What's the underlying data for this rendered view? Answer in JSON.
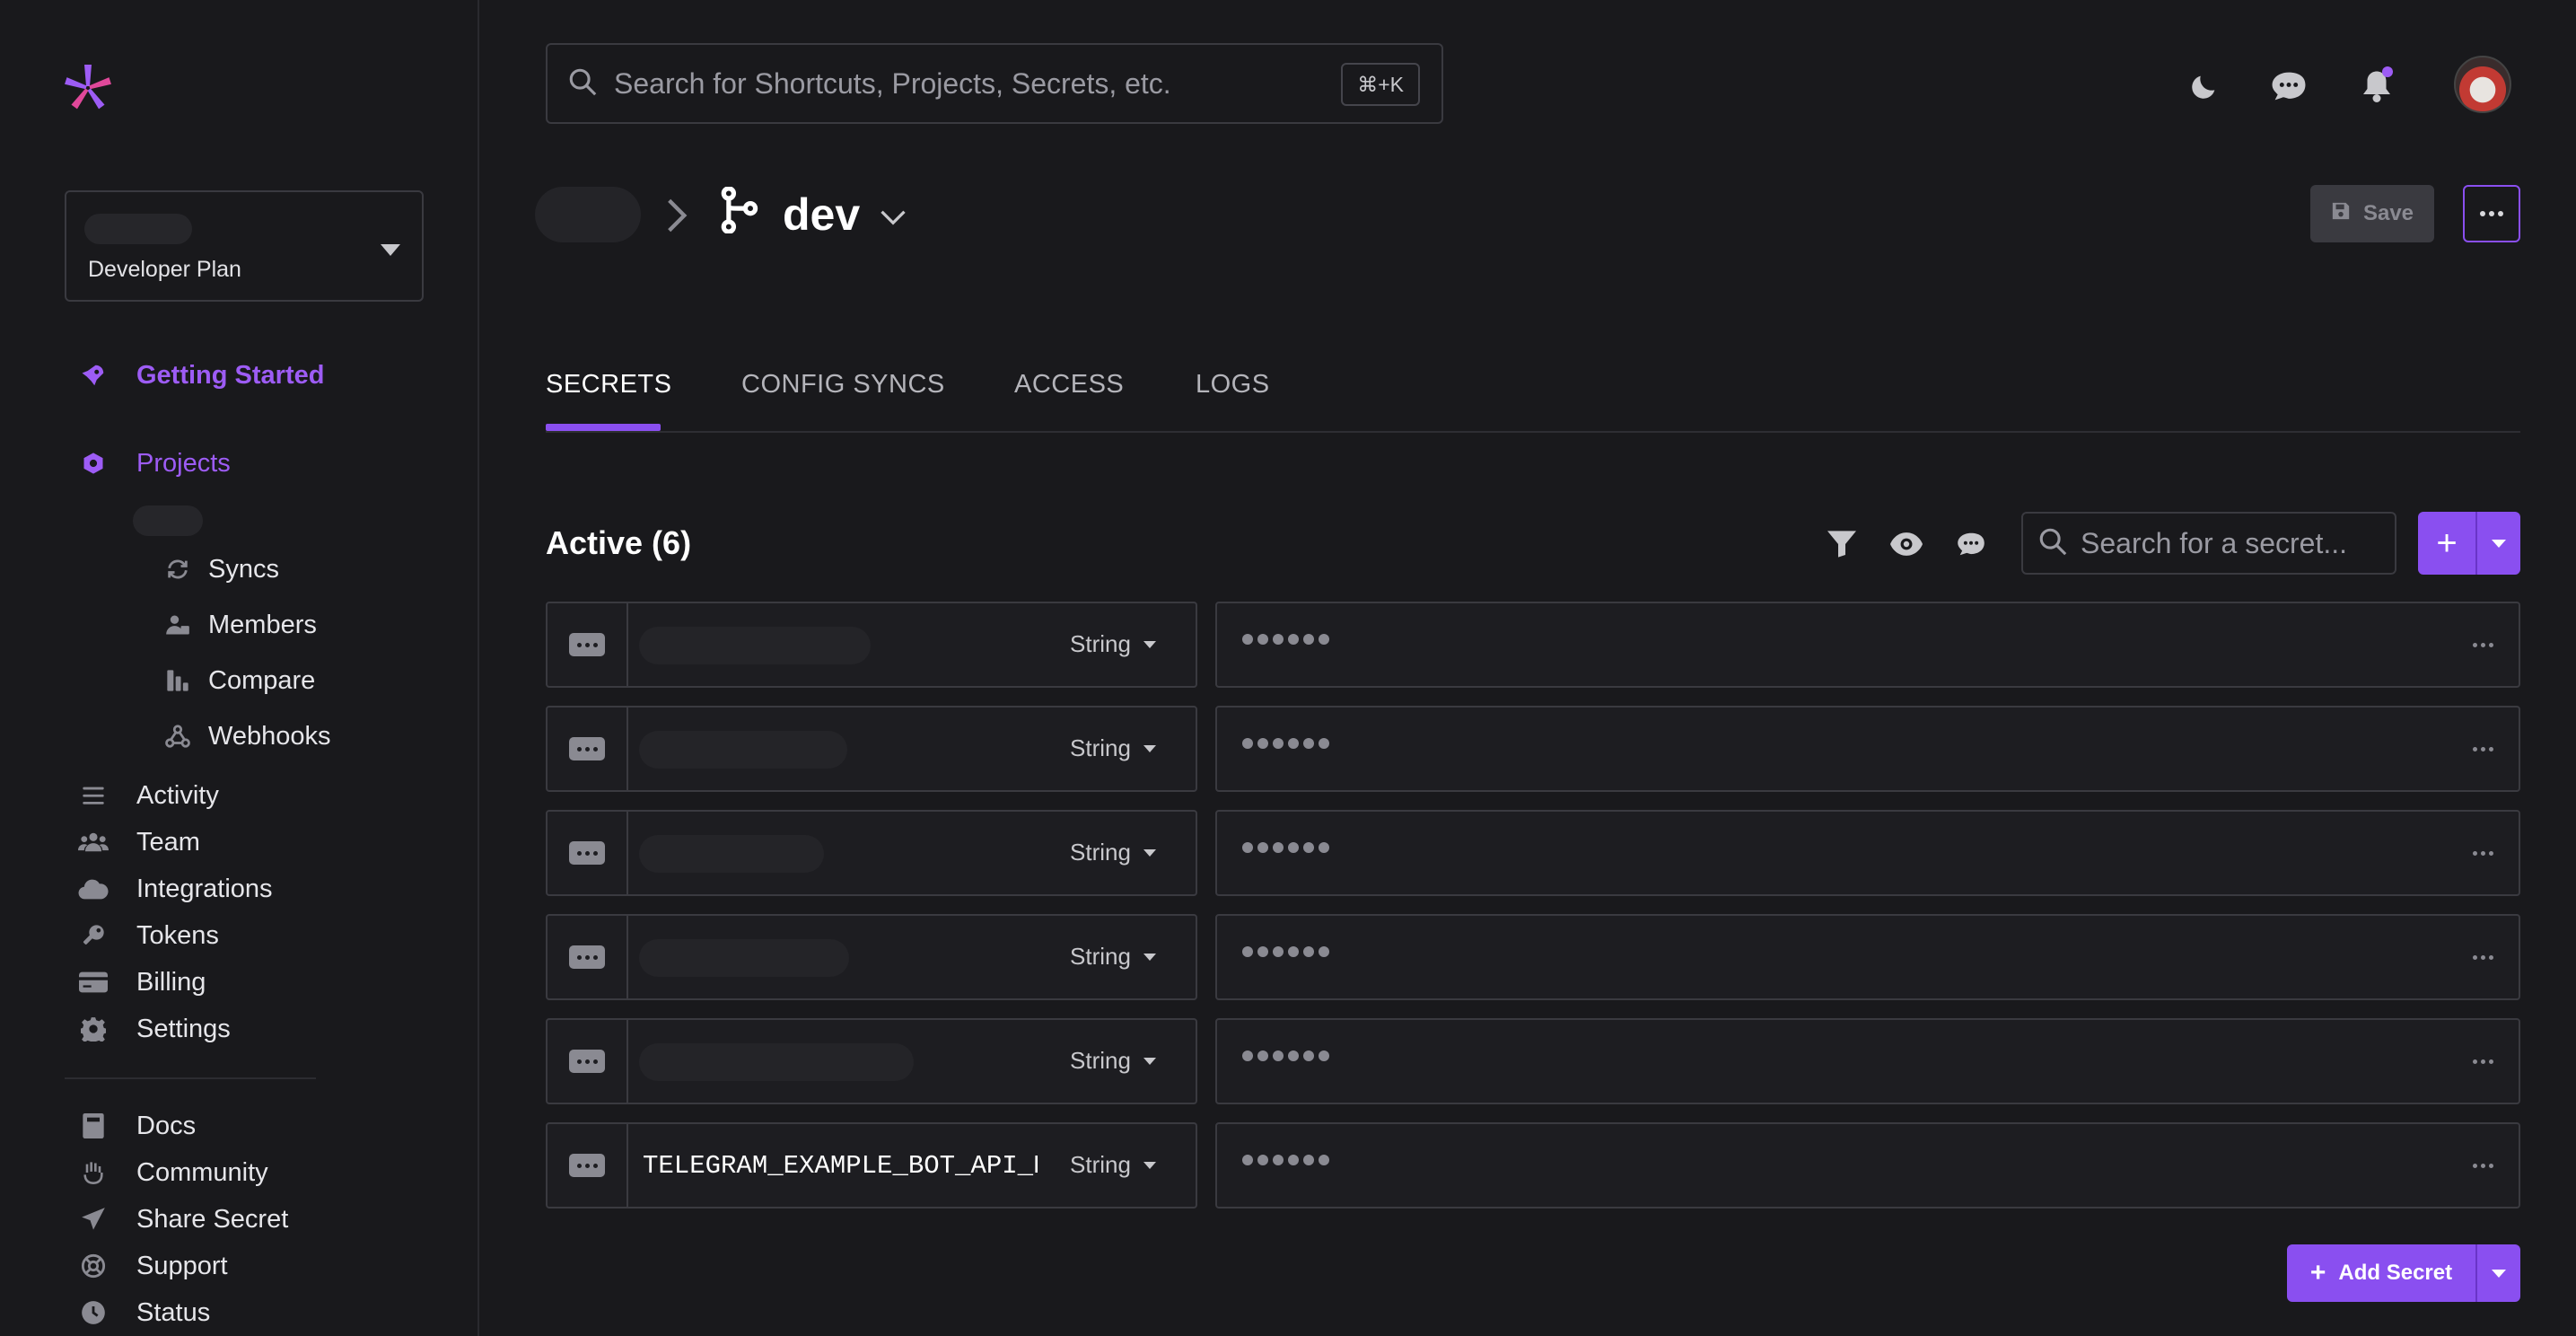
{
  "sidebar": {
    "plan_label": "Developer Plan",
    "primary": [
      {
        "label": "Getting Started",
        "icon": "rocket-icon"
      },
      {
        "label": "Projects",
        "icon": "hexagon-gear-icon"
      }
    ],
    "project_sub": [
      {
        "label": "Syncs",
        "icon": "sync-icon"
      },
      {
        "label": "Members",
        "icon": "members-icon"
      },
      {
        "label": "Compare",
        "icon": "compare-icon"
      },
      {
        "label": "Webhooks",
        "icon": "webhooks-icon"
      }
    ],
    "items": [
      {
        "label": "Activity",
        "icon": "list-icon"
      },
      {
        "label": "Team",
        "icon": "team-icon"
      },
      {
        "label": "Integrations",
        "icon": "cloud-icon"
      },
      {
        "label": "Tokens",
        "icon": "key-icon"
      },
      {
        "label": "Billing",
        "icon": "credit-card-icon"
      },
      {
        "label": "Settings",
        "icon": "gear-icon"
      }
    ],
    "footer": [
      {
        "label": "Docs",
        "icon": "book-icon"
      },
      {
        "label": "Community",
        "icon": "hand-icon"
      },
      {
        "label": "Share Secret",
        "icon": "paper-plane-icon"
      },
      {
        "label": "Support",
        "icon": "lifebuoy-icon"
      },
      {
        "label": "Status",
        "icon": "clock-icon"
      }
    ]
  },
  "topbar": {
    "search_placeholder": "Search for Shortcuts, Projects, Secrets, etc.",
    "shortcut": "⌘+K"
  },
  "header": {
    "environment": "dev",
    "save_label": "Save"
  },
  "tabs": [
    "SECRETS",
    "CONFIG SYNCS",
    "ACCESS",
    "LOGS"
  ],
  "secrets": {
    "title": "Active (6)",
    "search_placeholder": "Search for a secret...",
    "rows": [
      {
        "key": "",
        "type": "String"
      },
      {
        "key": "",
        "type": "String"
      },
      {
        "key": "",
        "type": "String"
      },
      {
        "key": "",
        "type": "String"
      },
      {
        "key": "",
        "type": "String"
      },
      {
        "key": "TELEGRAM_EXAMPLE_BOT_API_KEY",
        "type": "String"
      }
    ],
    "add_label": "Add Secret"
  },
  "colors": {
    "accent": "#8a4ff0",
    "accent_text": "#9d5cf5",
    "background": "#19191c",
    "border": "#3a3a40"
  }
}
